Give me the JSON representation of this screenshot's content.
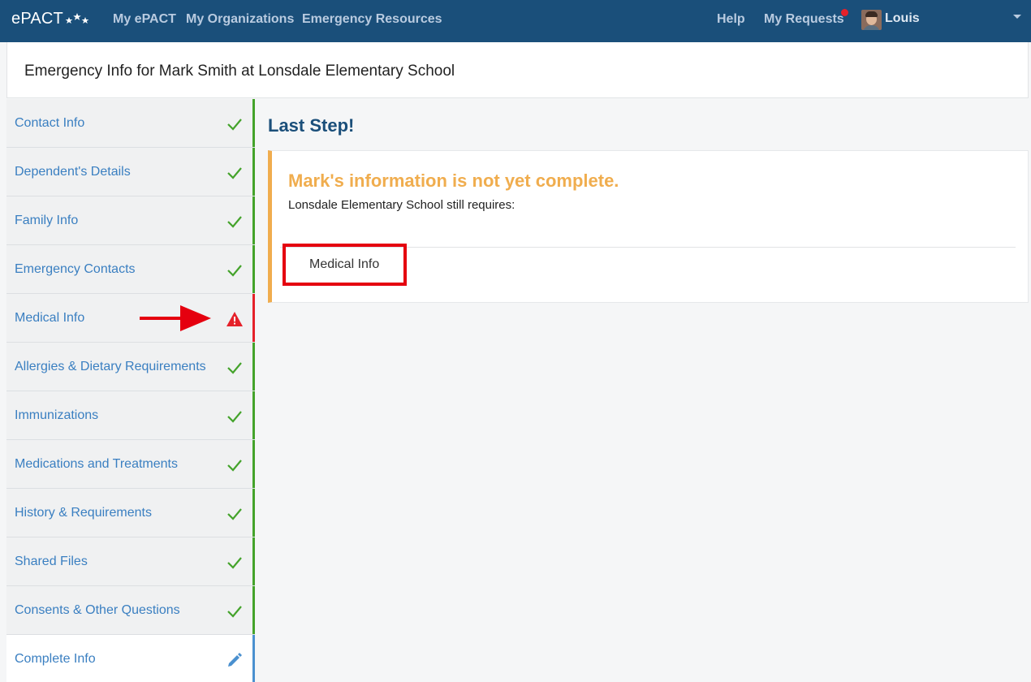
{
  "nav": {
    "brand": "ePACT",
    "links": [
      "My ePACT",
      "My Organizations",
      "Emergency Resources"
    ],
    "help": "Help",
    "requests": "My Requests",
    "user": "Louis"
  },
  "header": {
    "title": "Emergency Info for Mark Smith at Lonsdale Elementary School"
  },
  "sidebar": {
    "items": [
      {
        "label": "Contact Info",
        "status": "complete"
      },
      {
        "label": "Dependent's Details",
        "status": "complete"
      },
      {
        "label": "Family Info",
        "status": "complete"
      },
      {
        "label": "Emergency Contacts",
        "status": "complete"
      },
      {
        "label": "Medical Info",
        "status": "warning"
      },
      {
        "label": "Allergies & Dietary Requirements",
        "status": "complete"
      },
      {
        "label": "Immunizations",
        "status": "complete"
      },
      {
        "label": "Medications and Treatments",
        "status": "complete"
      },
      {
        "label": "History & Requirements",
        "status": "complete"
      },
      {
        "label": "Shared Files",
        "status": "complete"
      },
      {
        "label": "Consents & Other Questions",
        "status": "complete"
      },
      {
        "label": "Complete Info",
        "status": "editing"
      }
    ]
  },
  "main": {
    "title": "Last Step!",
    "alert_heading": "Mark's information is not yet complete.",
    "alert_sub": "Lonsdale Elementary School still requires:",
    "required_items": [
      "Medical Info"
    ]
  },
  "colors": {
    "navbar": "#1a4f7a",
    "link": "#3a7fc1",
    "complete": "#44a32b",
    "warning": "#e5212a",
    "alert": "#f0ad4e",
    "active": "#4a90cf"
  }
}
